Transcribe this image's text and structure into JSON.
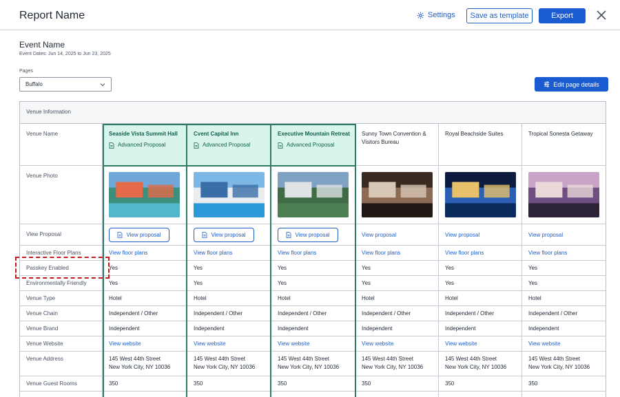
{
  "header": {
    "title": "Report Name",
    "settings_label": "Settings",
    "save_template_label": "Save as template",
    "export_label": "Export"
  },
  "event": {
    "name": "Event Name",
    "dates": "Event Dates: Jun 14, 2025 to Jun 23, 2025"
  },
  "pages": {
    "label": "Pages",
    "selected": "Buffalo",
    "edit_label": "Edit page details"
  },
  "table": {
    "section_title": "Venue Information",
    "row_labels": {
      "venue_name": "Venue Name",
      "venue_photo": "Venue Photo",
      "view_proposal": "View Proposal",
      "floor_plans": "Interactive Floor Plans",
      "passkey": "Passkey Enabled",
      "env": "Environmentally Friendly",
      "type": "Venue Type",
      "chain": "Venue Chain",
      "brand": "Venue Brand",
      "website": "Venue Website",
      "address": "Venue Address",
      "rooms": "Venue Guest Rooms"
    },
    "venues": [
      {
        "name": "Seaside Vista Summit Hall",
        "proposal_tag": "Advanced Proposal",
        "proposal_link": "View proposal",
        "floor_plans": "View floor plans",
        "passkey": "Yes",
        "env": "Yes",
        "type": "Hotel",
        "chain": "Independent / Other",
        "brand": "Independent",
        "website": "View website",
        "address1": "145 West 44th Street",
        "address2": "New York City, NY 10036",
        "rooms": "350"
      },
      {
        "name": "Cvent Capital Inn",
        "proposal_tag": "Advanced Proposal",
        "proposal_link": "View proposal",
        "floor_plans": "View floor plans",
        "passkey": "Yes",
        "env": "Yes",
        "type": "Hotel",
        "chain": "Independent / Other",
        "brand": "Independent",
        "website": "View website",
        "address1": "145 West 44th Street",
        "address2": "New York City, NY 10036",
        "rooms": "350"
      },
      {
        "name": "Executive Mountain Retreat",
        "proposal_tag": "Advanced Proposal",
        "proposal_link": "View proposal",
        "floor_plans": "View floor plans",
        "passkey": "Yes",
        "env": "Yes",
        "type": "Hotel",
        "chain": "Independent / Other",
        "brand": "Independent",
        "website": "View website",
        "address1": "145 West 44th Street",
        "address2": "New York City, NY 10036",
        "rooms": "350"
      },
      {
        "name": "Sunny Town Convention & Visitors Bureau",
        "proposal_tag": "",
        "proposal_link": "View proposal",
        "floor_plans": "View floor plans",
        "passkey": "Yes",
        "env": "Yes",
        "type": "Hotel",
        "chain": "Independent / Other",
        "brand": "Independent",
        "website": "View website",
        "address1": "145 West 44th Street",
        "address2": "New York City, NY 10036",
        "rooms": "350"
      },
      {
        "name": "Royal Beachside Suites",
        "proposal_tag": "",
        "proposal_link": "View proposal",
        "floor_plans": "View floor plans",
        "passkey": "Yes",
        "env": "Yes",
        "type": "Hotel",
        "chain": "Independent / Other",
        "brand": "Independent",
        "website": "View website",
        "address1": "145 West 44th Street",
        "address2": "New York City, NY 10036",
        "rooms": "350"
      },
      {
        "name": "Tropical Sonesta Getaway",
        "proposal_tag": "",
        "proposal_link": "View proposal",
        "floor_plans": "View floor plans",
        "passkey": "Yes",
        "env": "Yes",
        "type": "Hotel",
        "chain": "Independent / Other",
        "brand": "Independent",
        "website": "View website",
        "address1": "145 West 44th Street",
        "address2": "New York City, NY 10036",
        "rooms": "350"
      }
    ]
  },
  "colors": {
    "accent": "#1b5bd1",
    "selected_bg": "#d7f5ec",
    "selected_border": "#2f7a63",
    "highlight_dash": "#c6191c"
  }
}
